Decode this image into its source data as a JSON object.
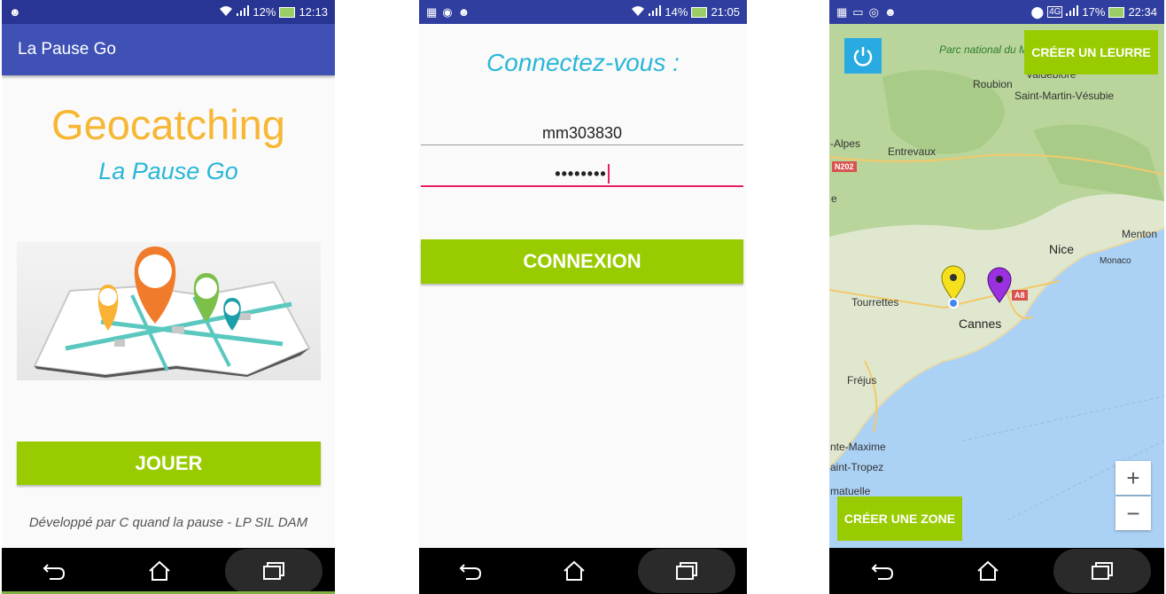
{
  "screens": [
    {
      "status": {
        "battery": "12%",
        "time": "12:13"
      },
      "app_title": "La Pause Go",
      "title": "Geocatching",
      "subtitle": "La Pause Go",
      "play_button": "JOUER",
      "footer": "Développé par C quand la pause - LP SIL DAM"
    },
    {
      "status": {
        "battery": "14%",
        "time": "21:05"
      },
      "title": "Connectez-vous :",
      "username_value": "mm303830",
      "password_value": "••••••••",
      "login_button": "CONNEXION"
    },
    {
      "status": {
        "battery": "17%",
        "time": "22:34",
        "network": "4G"
      },
      "create_decoy_button": "CRÉER UN LEURRE",
      "create_zone_button": "CRÉER UNE ZONE",
      "zoom_in": "+",
      "zoom_out": "−",
      "map_labels": {
        "park": "Parc national du Mercantour",
        "valdeblore": "Valdeblore",
        "roubion": "Roubion",
        "st_martin": "Saint-Martin-Vésubie",
        "alpes": "-Alpes",
        "entrevaux": "Entrevaux",
        "n202": "N202",
        "e": "e",
        "nice": "Nice",
        "menton": "Menton",
        "monaco": "Monaco",
        "tourrettes": "Tourrettes",
        "cannes": "Cannes",
        "a8": "A8",
        "frejus": "Fréjus",
        "ste_maxime": "nte-Maxime",
        "st_tropez": "aint-Tropez",
        "ramatuelle": "matuelle"
      },
      "marker_colors": {
        "yellow": "#f5e11b",
        "purple": "#9b30e0",
        "location": "#4285f4"
      }
    }
  ],
  "colors": {
    "accent_green": "#99cc00",
    "title_orange": "#f7b733",
    "title_blue": "#29b6d8",
    "appbar": "#3f51b5"
  }
}
